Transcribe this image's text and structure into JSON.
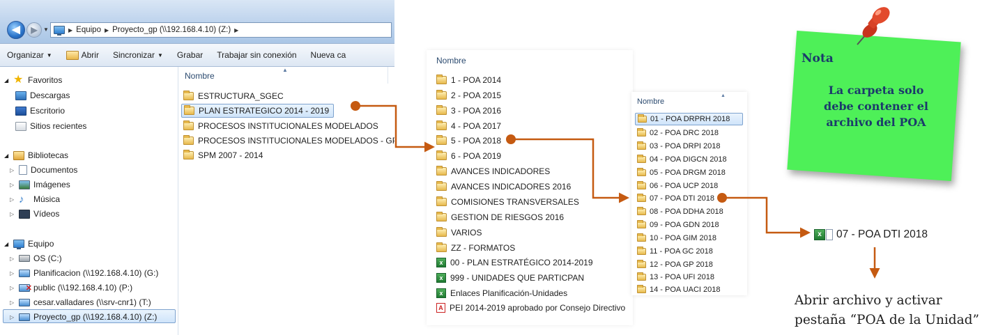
{
  "explorer": {
    "breadcrumb": [
      "Equipo",
      "Proyecto_gp (\\\\192.168.4.10) (Z:)"
    ],
    "toolbar": {
      "organize": "Organizar",
      "open": "Abrir",
      "sync": "Sincronizar",
      "burn": "Grabar",
      "offline": "Trabajar sin conexión",
      "new_folder": "Nueva ca"
    },
    "nav": {
      "favorites": "Favoritos",
      "downloads": "Descargas",
      "desktop": "Escritorio",
      "recent": "Sitios recientes",
      "libraries": "Bibliotecas",
      "documents": "Documentos",
      "images": "Imágenes",
      "music": "Música",
      "videos": "Vídeos",
      "computer": "Equipo",
      "drive_c": "OS (C:)",
      "drive_g": "Planificacion (\\\\192.168.4.10) (G:)",
      "drive_p": "public (\\\\192.168.4.10) (P:)",
      "drive_t": "cesar.valladares (\\\\srv-cnr1) (T:)",
      "drive_z": "Proyecto_gp (\\\\192.168.4.10) (Z:)"
    },
    "column_name": "Nombre",
    "files": [
      "ESTRUCTURA_SGEC",
      "PLAN ESTRATEGICO 2014 - 2019",
      "PROCESOS INSTITUCIONALES MODELADOS",
      "PROCESOS INSTITUCIONALES MODELADOS - GP",
      "SPM 2007 - 2014"
    ]
  },
  "list2": {
    "column_name": "Nombre",
    "folders": [
      "1 - POA 2014",
      "2 - POA 2015",
      "3 - POA 2016",
      "4 - POA 2017",
      "5 - POA 2018",
      "6 - POA 2019",
      "AVANCES INDICADORES",
      "AVANCES INDICADORES 2016",
      "COMISIONES TRANSVERSALES",
      "GESTION DE RIESGOS 2016",
      "VARIOS",
      "ZZ - FORMATOS"
    ],
    "files": [
      "00 - PLAN ESTRATÉGICO 2014-2019",
      "999 - UNIDADES QUE PARTICPAN",
      "Enlaces Planificación-Unidades",
      "PEI 2014-2019 aprobado por Consejo Directivo"
    ]
  },
  "list3": {
    "column_name": "Nombre",
    "folders": [
      "01 - POA DRPRH 2018",
      "02 - POA DRC 2018",
      "03 - POA DRPI 2018",
      "04 - POA DIGCN 2018",
      "05 - POA DRGM 2018",
      "06 - POA UCP 2018",
      "07 - POA DTI 2018",
      "08 - POA DDHA 2018",
      "09 - POA GDN 2018",
      "10 - POA GIM 2018",
      "11 - POA GC 2018",
      "12 - POA GP 2018",
      "13 - POA UFI 2018",
      "14 - POA UACI 2018"
    ]
  },
  "note": {
    "title": "Nota",
    "line1": "La carpeta solo",
    "line2": "debe contener el",
    "line3": "archivo del POA"
  },
  "result_file": "07 - POA DTI 2018",
  "instruction": {
    "line1": "Abrir archivo y activar",
    "line2": "pestaña “POA de la Unidad”"
  },
  "colors": {
    "arrow": "#c55a11",
    "note": "#4ef058",
    "note_text": "#1b3a6b"
  }
}
